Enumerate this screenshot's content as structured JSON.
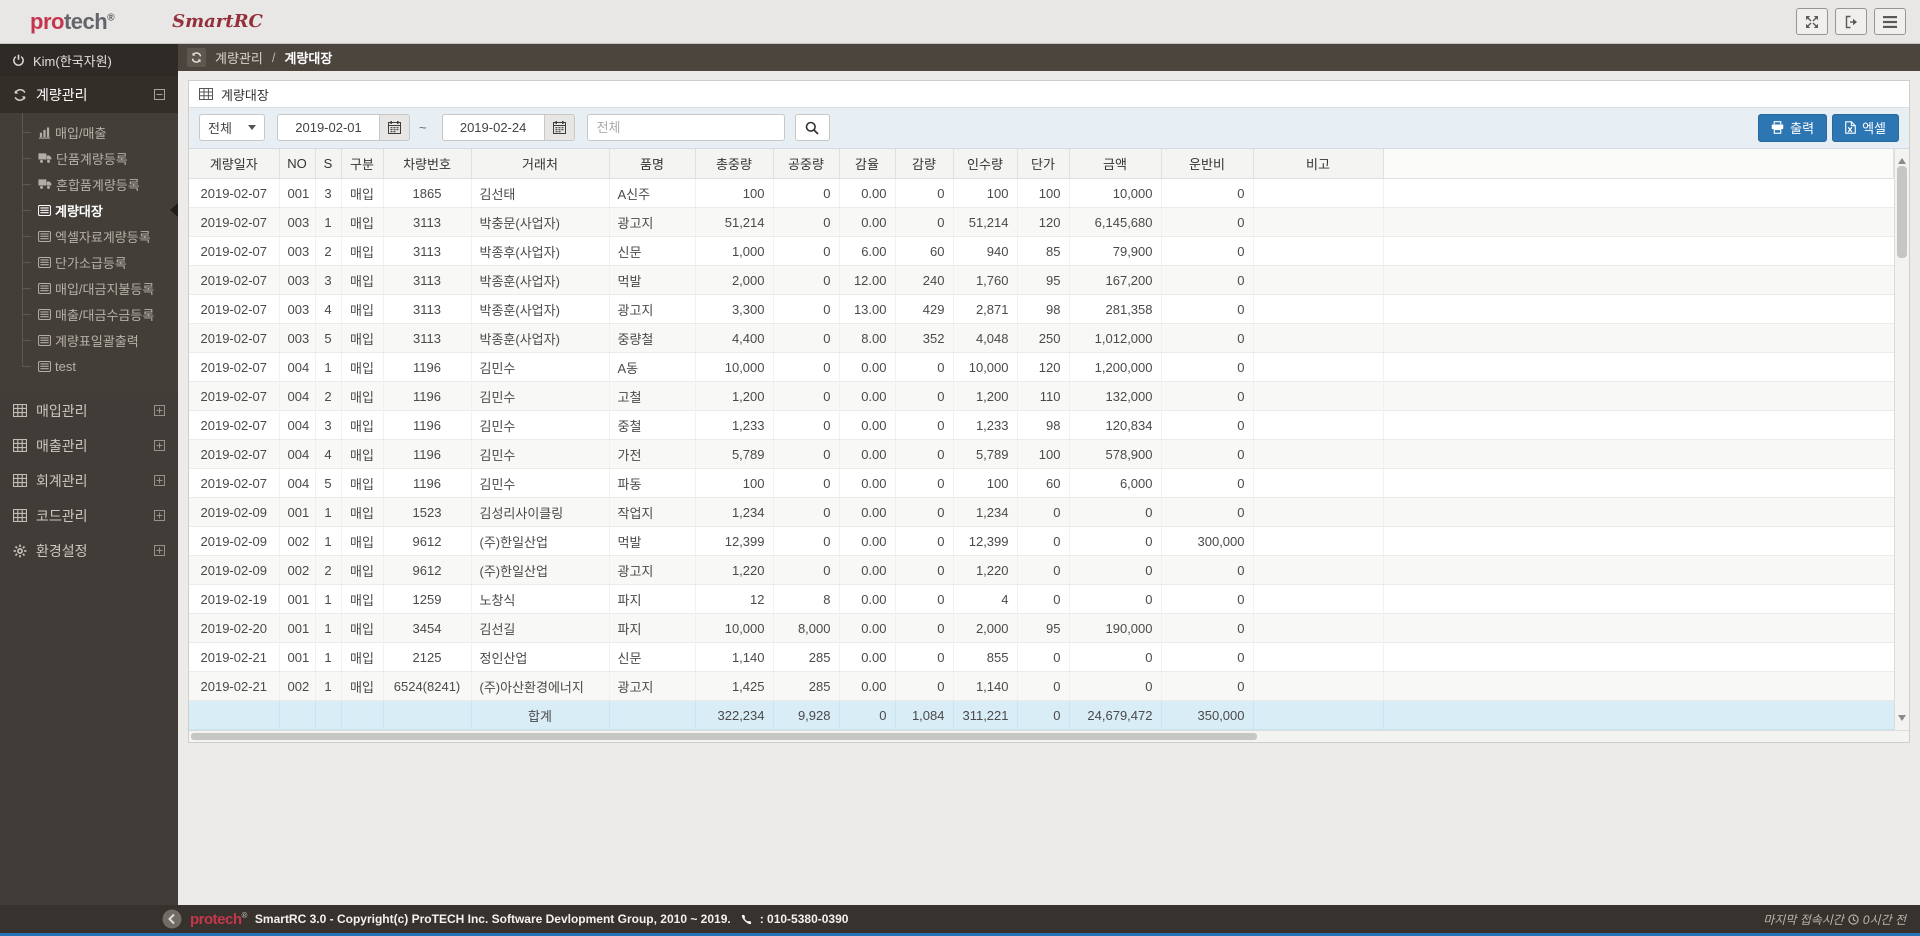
{
  "header": {
    "logo_part1": "pro",
    "logo_part2": "tech",
    "logo_reg": "®",
    "brand": "SmartRC"
  },
  "sidebar": {
    "user": "Kim(한국자원)",
    "group_label": "계량관리",
    "group_icon": "recycle",
    "group_items": [
      {
        "label": "매입/매출",
        "icon": "chart"
      },
      {
        "label": "단품계량등록",
        "icon": "truck"
      },
      {
        "label": "혼합품계량등록",
        "icon": "truck"
      },
      {
        "label": "계량대장",
        "icon": "list",
        "active": true
      },
      {
        "label": "엑셀자료계량등록",
        "icon": "list"
      },
      {
        "label": "단가소급등록",
        "icon": "list"
      },
      {
        "label": "매입/대금지불등록",
        "icon": "list"
      },
      {
        "label": "매출/대금수금등록",
        "icon": "list"
      },
      {
        "label": "계량표일괄출력",
        "icon": "list"
      },
      {
        "label": "test",
        "icon": "list"
      }
    ],
    "top_items": [
      {
        "label": "매입관리",
        "icon": "grid"
      },
      {
        "label": "매출관리",
        "icon": "grid"
      },
      {
        "label": "회계관리",
        "icon": "grid"
      },
      {
        "label": "코드관리",
        "icon": "grid"
      },
      {
        "label": "환경설정",
        "icon": "gear"
      }
    ]
  },
  "breadcrumb": {
    "section": "계량관리",
    "separator": "/",
    "page": "계량대장"
  },
  "panel": {
    "title": "계량대장",
    "filters": {
      "category": "전체",
      "date_from": "2019-02-01",
      "range_separator": "~",
      "date_to": "2019-02-24",
      "search_placeholder": "전체"
    },
    "buttons": {
      "print": "출력",
      "excel": "엑셀"
    }
  },
  "table": {
    "columns": [
      "계량일자",
      "NO",
      "S",
      "구분",
      "차량번호",
      "거래처",
      "품명",
      "총중량",
      "공중량",
      "감율",
      "감량",
      "인수량",
      "단가",
      "금액",
      "운반비",
      "비고"
    ],
    "rows": [
      [
        "2019-02-07",
        "001",
        "3",
        "매입",
        "1865",
        "김선태",
        "A신주",
        "100",
        "0",
        "0.00",
        "0",
        "100",
        "100",
        "10,000",
        "0",
        ""
      ],
      [
        "2019-02-07",
        "003",
        "1",
        "매입",
        "3113",
        "박충문(사업자)",
        "광고지",
        "51,214",
        "0",
        "0.00",
        "0",
        "51,214",
        "120",
        "6,145,680",
        "0",
        ""
      ],
      [
        "2019-02-07",
        "003",
        "2",
        "매입",
        "3113",
        "박종후(사업자)",
        "신문",
        "1,000",
        "0",
        "6.00",
        "60",
        "940",
        "85",
        "79,900",
        "0",
        ""
      ],
      [
        "2019-02-07",
        "003",
        "3",
        "매입",
        "3113",
        "박종훈(사업자)",
        "먹발",
        "2,000",
        "0",
        "12.00",
        "240",
        "1,760",
        "95",
        "167,200",
        "0",
        ""
      ],
      [
        "2019-02-07",
        "003",
        "4",
        "매입",
        "3113",
        "박종훈(사업자)",
        "광고지",
        "3,300",
        "0",
        "13.00",
        "429",
        "2,871",
        "98",
        "281,358",
        "0",
        ""
      ],
      [
        "2019-02-07",
        "003",
        "5",
        "매입",
        "3113",
        "박종훈(사업자)",
        "중량철",
        "4,400",
        "0",
        "8.00",
        "352",
        "4,048",
        "250",
        "1,012,000",
        "0",
        ""
      ],
      [
        "2019-02-07",
        "004",
        "1",
        "매입",
        "1196",
        "김민수",
        "A동",
        "10,000",
        "0",
        "0.00",
        "0",
        "10,000",
        "120",
        "1,200,000",
        "0",
        ""
      ],
      [
        "2019-02-07",
        "004",
        "2",
        "매입",
        "1196",
        "김민수",
        "고철",
        "1,200",
        "0",
        "0.00",
        "0",
        "1,200",
        "110",
        "132,000",
        "0",
        ""
      ],
      [
        "2019-02-07",
        "004",
        "3",
        "매입",
        "1196",
        "김민수",
        "중철",
        "1,233",
        "0",
        "0.00",
        "0",
        "1,233",
        "98",
        "120,834",
        "0",
        ""
      ],
      [
        "2019-02-07",
        "004",
        "4",
        "매입",
        "1196",
        "김민수",
        "가전",
        "5,789",
        "0",
        "0.00",
        "0",
        "5,789",
        "100",
        "578,900",
        "0",
        ""
      ],
      [
        "2019-02-07",
        "004",
        "5",
        "매입",
        "1196",
        "김민수",
        "파동",
        "100",
        "0",
        "0.00",
        "0",
        "100",
        "60",
        "6,000",
        "0",
        ""
      ],
      [
        "2019-02-09",
        "001",
        "1",
        "매입",
        "1523",
        "김성리사이클링",
        "작업지",
        "1,234",
        "0",
        "0.00",
        "0",
        "1,234",
        "0",
        "0",
        "0",
        ""
      ],
      [
        "2019-02-09",
        "002",
        "1",
        "매입",
        "9612",
        "(주)한일산업",
        "먹발",
        "12,399",
        "0",
        "0.00",
        "0",
        "12,399",
        "0",
        "0",
        "300,000",
        ""
      ],
      [
        "2019-02-09",
        "002",
        "2",
        "매입",
        "9612",
        "(주)한일산업",
        "광고지",
        "1,220",
        "0",
        "0.00",
        "0",
        "1,220",
        "0",
        "0",
        "0",
        ""
      ],
      [
        "2019-02-19",
        "001",
        "1",
        "매입",
        "1259",
        "노창식",
        "파지",
        "12",
        "8",
        "0.00",
        "0",
        "4",
        "0",
        "0",
        "0",
        ""
      ],
      [
        "2019-02-20",
        "001",
        "1",
        "매입",
        "3454",
        "김선길",
        "파지",
        "10,000",
        "8,000",
        "0.00",
        "0",
        "2,000",
        "95",
        "190,000",
        "0",
        ""
      ],
      [
        "2019-02-21",
        "001",
        "1",
        "매입",
        "2125",
        "정인산업",
        "신문",
        "1,140",
        "285",
        "0.00",
        "0",
        "855",
        "0",
        "0",
        "0",
        ""
      ],
      [
        "2019-02-21",
        "002",
        "1",
        "매입",
        "6524(8241)",
        "(주)아산환경에너지",
        "광고지",
        "1,425",
        "285",
        "0.00",
        "0",
        "1,140",
        "0",
        "0",
        "0",
        ""
      ]
    ],
    "total": [
      "",
      "",
      "",
      "",
      "",
      "합계",
      "",
      "322,234",
      "9,928",
      "0",
      "1,084",
      "311,221",
      "0",
      "24,679,472",
      "350,000",
      ""
    ]
  },
  "footer": {
    "brand": "protech",
    "reg": "®",
    "text": "SmartRC 3.0 - Copyright(c) ProTECH Inc. Software Devlopment Group, 2010 ~ 2019.",
    "phone": ": 010-5380-0390",
    "last_access_label": "마지막 접속시간",
    "last_access_value": "0시간 전"
  }
}
